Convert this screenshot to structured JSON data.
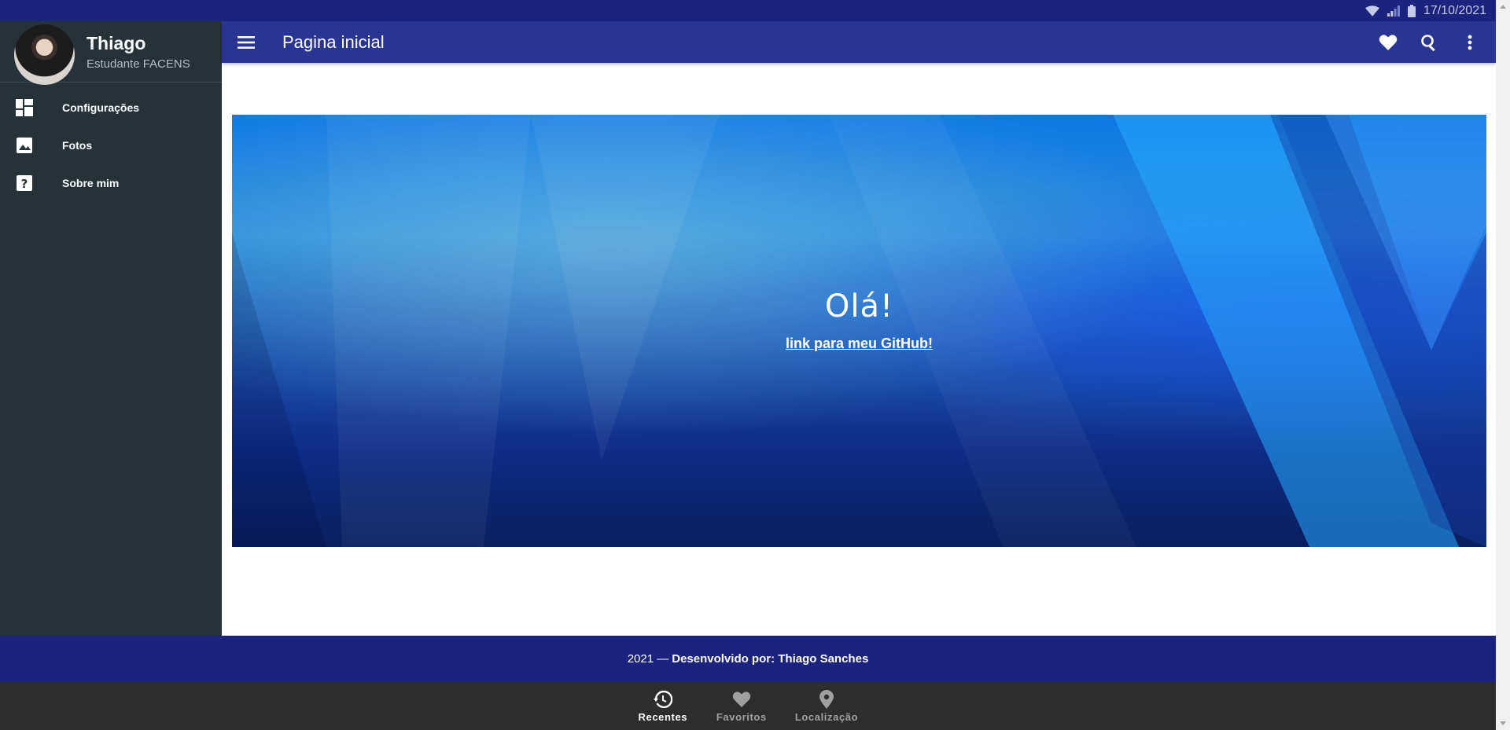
{
  "status_bar": {
    "date": "17/10/2021",
    "icons": [
      "wifi-icon",
      "signal-icon",
      "battery-icon"
    ]
  },
  "sidebar": {
    "profile": {
      "name": "Thiago",
      "subtitle": "Estudante FACENS"
    },
    "items": [
      {
        "label": "Configurações",
        "icon": "dashboard-icon"
      },
      {
        "label": "Fotos",
        "icon": "image-icon"
      },
      {
        "label": "Sobre mim",
        "icon": "help-icon"
      }
    ]
  },
  "app_bar": {
    "title": "Pagina inicial",
    "actions": [
      "favorite-icon",
      "search-icon",
      "more-vert-icon"
    ]
  },
  "hero": {
    "title": "Olá!",
    "link_text": "link para meu GitHub!"
  },
  "footer": {
    "year_prefix": "2021 —",
    "developer": "Desenvolvido por: Thiago Sanches"
  },
  "bottom_nav": {
    "items": [
      {
        "label": "Recentes",
        "icon": "history-icon",
        "active": true
      },
      {
        "label": "Favoritos",
        "icon": "favorite-icon",
        "active": false
      },
      {
        "label": "Localização",
        "icon": "location-icon",
        "active": false
      }
    ]
  },
  "colors": {
    "status_bar": "#1a237e",
    "app_bar": "#283593",
    "sidebar": "#263238",
    "footer": "#1a237e",
    "bottom_nav": "#2d2d2d"
  }
}
